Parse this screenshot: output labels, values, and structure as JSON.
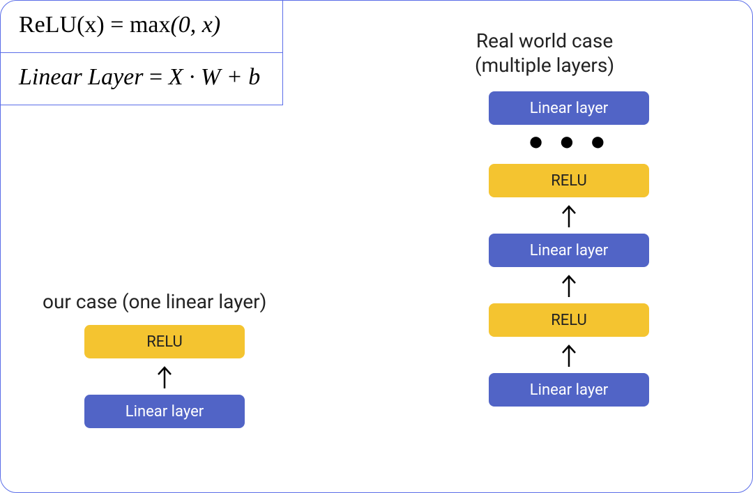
{
  "formulas": {
    "relu_lhs": "ReLU(x)",
    "relu_eq": " = ",
    "relu_rhs_op": "max",
    "relu_rhs_args": "(0, x)",
    "linear_lhs": "Linear  Layer",
    "linear_eq": " = ",
    "linear_rhs": "X · W + b"
  },
  "captions": {
    "left": "our case (one linear layer)",
    "right_line1": "Real world case",
    "right_line2": "(multiple layers)"
  },
  "blocks": {
    "linear_label": "Linear layer",
    "relu_label": "RELU"
  },
  "dots": "● ● ●"
}
